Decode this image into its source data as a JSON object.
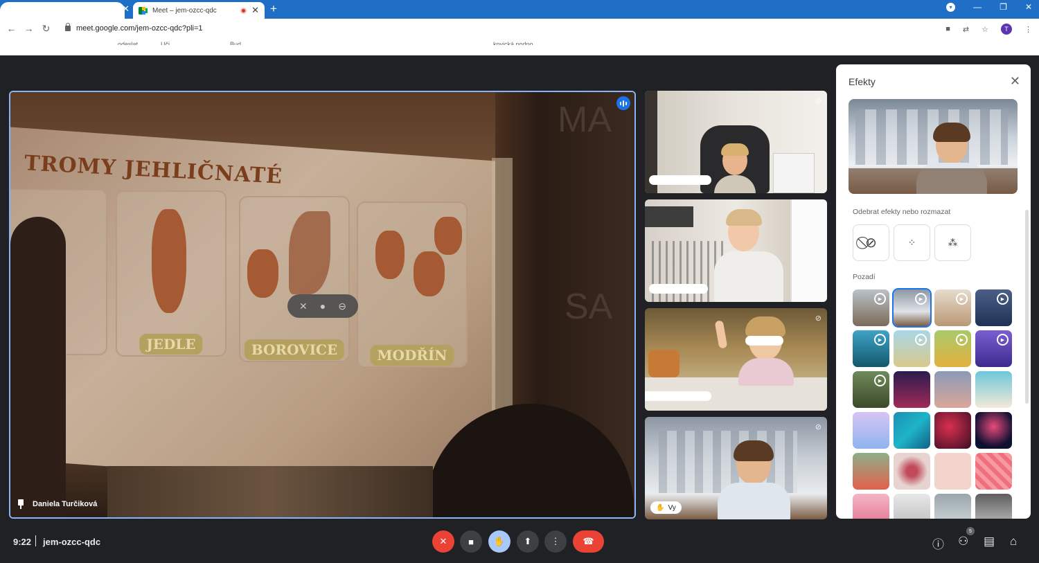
{
  "browser": {
    "tab_title": "Meet – jem-ozcc-qdc",
    "url": "meet.google.com/jem-ozcc-qdc?pli=1",
    "profile_initial": "T",
    "bookmark_fragments": [
      "odeslat",
      "Uči",
      "Bud",
      "kovická podpo"
    ]
  },
  "main_tile": {
    "slide_title": "TROMY JEHLIČNATÉ",
    "cards": [
      "JEDLE",
      "BOROVICE",
      "MODŘÍN"
    ],
    "wall_letters": [
      "MA",
      "SA"
    ],
    "presenter_name": "Daniela Turčiková"
  },
  "self_tile": {
    "you_label": "Vy"
  },
  "effects": {
    "title": "Efekty",
    "remove_label": "Odebrat efekty nebo rozmazat",
    "backgrounds_label": "Pozadí"
  },
  "bottom_bar": {
    "time": "9:22",
    "meeting_code": "jem-ozcc-qdc",
    "participants_count": "5"
  },
  "colors": {
    "accent": "#1a73e8",
    "danger": "#ea4335",
    "surface": "#202124"
  }
}
